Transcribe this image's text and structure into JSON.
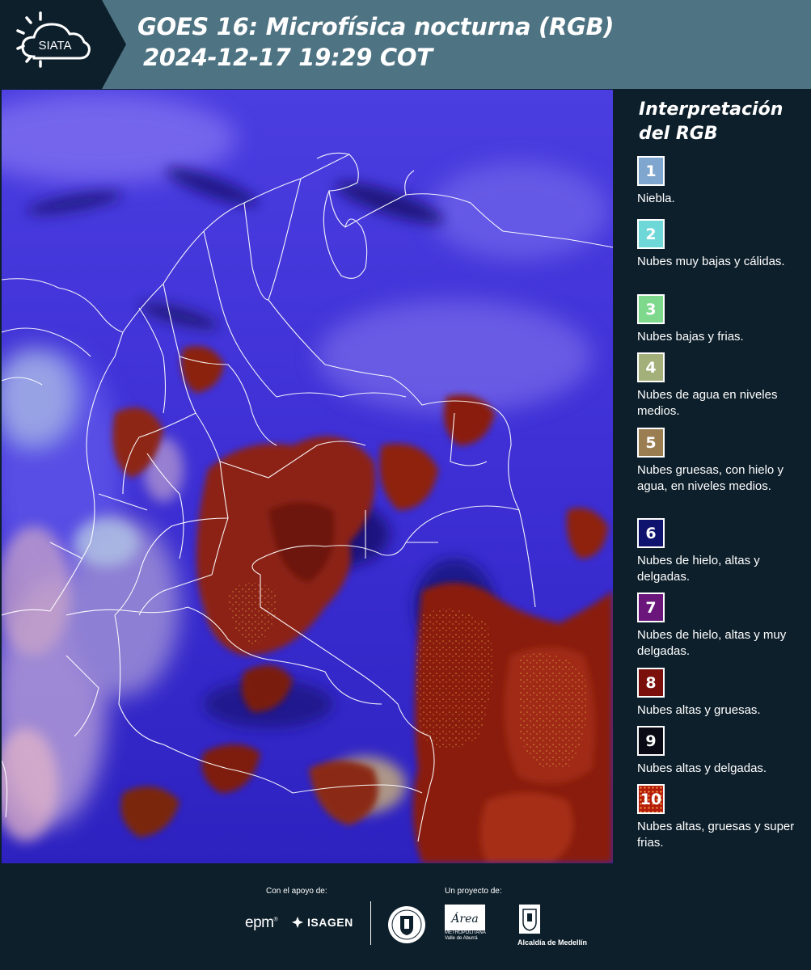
{
  "header": {
    "logo_text": "SIATA",
    "title_line1": "GOES 16: Microfísica nocturna (RGB)",
    "title_line2": "2024-12-17 19:29 COT"
  },
  "legend": {
    "title_line1": "Interpretación",
    "title_line2": "del RGB",
    "items": [
      {
        "number": "1",
        "color": "#7fa6cf",
        "label": "Niebla."
      },
      {
        "number": "2",
        "color": "#6ed8d8",
        "label": "Nubes muy bajas y cálidas."
      },
      {
        "number": "3",
        "color": "#7ed98c",
        "label": "Nubes bajas y frias."
      },
      {
        "number": "4",
        "color": "#a3b079",
        "label": "Nubes de agua en niveles medios."
      },
      {
        "number": "5",
        "color": "#9b7d52",
        "label": "Nubes gruesas, con hielo y agua, en niveles medios."
      },
      {
        "number": "6",
        "color": "#10136e",
        "label": "Nubes de hielo, altas y delgadas."
      },
      {
        "number": "7",
        "color": "#6a167a",
        "label": "Nubes de hielo, altas y muy delgadas."
      },
      {
        "number": "8",
        "color": "#7a0f0b",
        "label": "Nubes altas y gruesas."
      },
      {
        "number": "9",
        "color": "#0a0a14",
        "label": "Nubes altas y delgadas."
      },
      {
        "number": "10",
        "color": "#b51c0c",
        "label": "Nubes altas, gruesas y super frias."
      }
    ]
  },
  "footer": {
    "support_label": "Con el apoyo de:",
    "project_label": "Un proyecto de:",
    "epm_text": "epm",
    "isagen_text": "ISAGEN",
    "area_text": "Área",
    "area_caption_line1": "METROPOLITANA",
    "area_caption_line2": "Valle de Aburrá",
    "alcaldia_text": "Alcaldía de Medellín"
  }
}
